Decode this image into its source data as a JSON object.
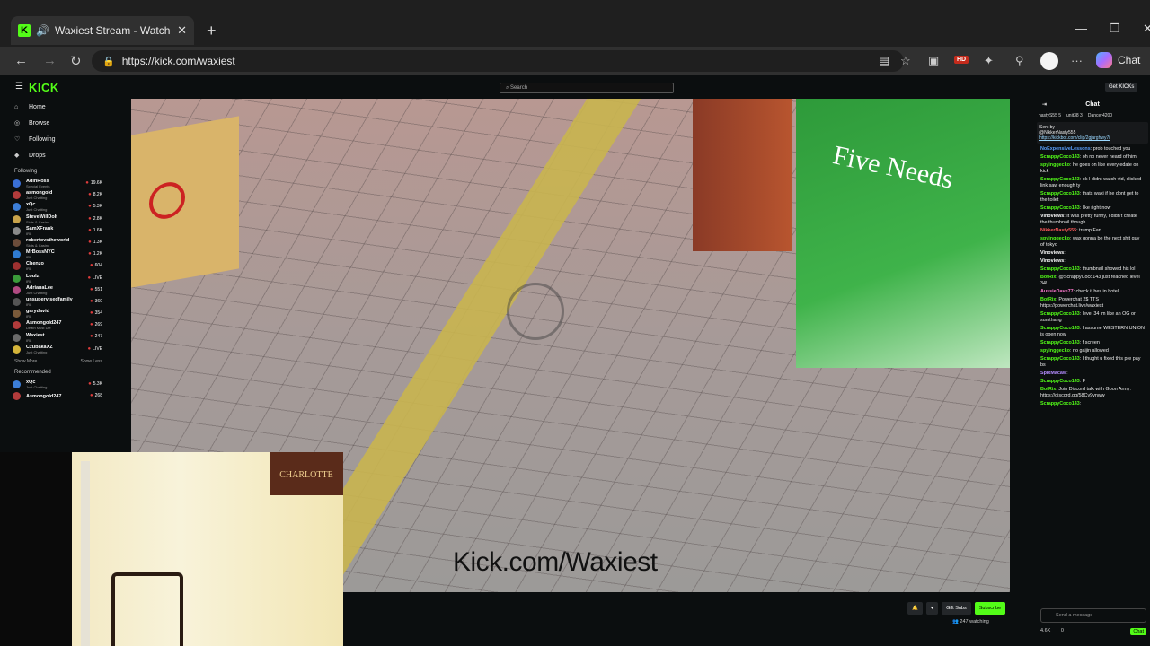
{
  "browser": {
    "tab_title": "Waxiest Stream - Watch Live o",
    "url": "https://kick.com/waxiest",
    "hd_badge": "HD",
    "chat_label": "Chat",
    "new_tab": "+",
    "close": "✕"
  },
  "kick": {
    "logo": "KICK",
    "search_placeholder": "Search",
    "get_kicks": "Get KICKs",
    "nav": [
      {
        "label": "Home",
        "icon": "home-icon"
      },
      {
        "label": "Browse",
        "icon": "browse-icon"
      },
      {
        "label": "Following",
        "icon": "heart-icon"
      },
      {
        "label": "Drops",
        "icon": "drops-icon"
      }
    ],
    "following_heading": "Following",
    "following": [
      {
        "name": "AdinRoss",
        "category": "Special Events",
        "viewers": "19.6K",
        "color": "#3a6fd6"
      },
      {
        "name": "asmongold",
        "category": "Just Chatting",
        "viewers": "8.2K",
        "color": "#b23b3b"
      },
      {
        "name": "xQc",
        "category": "Just Chatting",
        "viewers": "5.3K",
        "color": "#3c7ed8"
      },
      {
        "name": "SteveWillDoIt",
        "category": "Slots & Casino",
        "viewers": "2.8K",
        "color": "#c8a24a"
      },
      {
        "name": "SamXFrank",
        "category": "IRL",
        "viewers": "1.6K",
        "color": "#8a8a8a"
      },
      {
        "name": "robertovstheworld",
        "category": "Slots & Casino",
        "viewers": "1.3K",
        "color": "#6b4c3a"
      },
      {
        "name": "MrBossNYC",
        "category": "IRL",
        "viewers": "1.2K",
        "color": "#2f7bd1"
      },
      {
        "name": "Chenzo",
        "category": "IRL",
        "viewers": "604",
        "color": "#9c3030"
      },
      {
        "name": "Loulz",
        "category": "IRL",
        "viewers": "LIVE",
        "color": "#3a9a3a"
      },
      {
        "name": "AdrianaLee",
        "category": "Just Chatting",
        "viewers": "551",
        "color": "#b04a82"
      },
      {
        "name": "unsupervisedfamily",
        "category": "IRL",
        "viewers": "360",
        "color": "#555"
      },
      {
        "name": "garydavid",
        "category": "IRL",
        "viewers": "354",
        "color": "#7a5a3a"
      },
      {
        "name": "Asmongold247",
        "category": "Death Must Die",
        "viewers": "269",
        "color": "#b23b3b"
      },
      {
        "name": "Waxiest",
        "category": "IRL",
        "viewers": "247",
        "color": "#6a6a6a"
      },
      {
        "name": "CzubakaXZ",
        "category": "Just Chatting",
        "viewers": "LIVE",
        "color": "#d4b43a"
      }
    ],
    "show_more": "Show More",
    "show_less": "Show Less",
    "recommended_heading": "Recommended",
    "recommended": [
      {
        "name": "xQc",
        "category": "Just Chatting",
        "viewers": "5.3K",
        "color": "#3c7ed8"
      },
      {
        "name": "Asmongold247",
        "category": "",
        "viewers": "268",
        "color": "#b23b3b"
      }
    ],
    "watermark": "Kick.com/Waxiest",
    "webcam_poster": "CHARLOTTE",
    "gift_subs": "Gift Subs",
    "subscribe": "Subscribe",
    "watching": "247 watching"
  },
  "chat": {
    "title": "Chat",
    "gifters": [
      "nastyS55 5",
      "unit38 3",
      "Dancer4200"
    ],
    "pinned_by": "Sent by",
    "pinned_user": "@NikkerNasty555",
    "pinned_link": "https://kickbot.com/clip/2gjarghwy7i",
    "messages": [
      {
        "user": "NoExpensiveLessons",
        "color": "#5aa0ff",
        "text": "prob touched you"
      },
      {
        "user": "ScrappyCoco143",
        "color": "#53fc18",
        "text": "oh no never heard of him"
      },
      {
        "user": "spyinggecko",
        "color": "#53fc18",
        "text": "he goes on like every edate on kick"
      },
      {
        "user": "ScrappyCoco143",
        "color": "#53fc18",
        "text": "ok I didnt watch vid, clicked link saw enough ty"
      },
      {
        "user": "ScrappyCoco143",
        "color": "#53fc18",
        "text": "thats waxi if he dont get to the toilet"
      },
      {
        "user": "ScrappyCoco143",
        "color": "#53fc18",
        "text": "like right now"
      },
      {
        "user": "Vinoviews",
        "color": "#ffffff",
        "text": "It was pretty funny, I didn't create the thumbnail though"
      },
      {
        "user": "NikkerNasty555",
        "color": "#ff5a5a",
        "text": "trump Fart"
      },
      {
        "user": "spyinggecko",
        "color": "#53fc18",
        "text": "wax gonna be the next shit guy of tokyo"
      },
      {
        "user": "Vinoviews",
        "color": "#ffffff",
        "text": ""
      },
      {
        "user": "Vinoviews",
        "color": "#ffffff",
        "text": ""
      },
      {
        "user": "ScrappyCoco143",
        "color": "#53fc18",
        "text": "thumbnail showed his lol"
      },
      {
        "user": "BotRix",
        "color": "#53fc18",
        "text": "@ScrappyCoco143 just reached level 34!"
      },
      {
        "user": "AussieDave77",
        "color": "#ff7ad0",
        "text": "check if hes in hotel"
      },
      {
        "user": "BotRix",
        "color": "#53fc18",
        "text": "Powerchat 2$ TTS https://powerchat.live/waxiest"
      },
      {
        "user": "ScrappyCoco143",
        "color": "#53fc18",
        "text": "level 34 im like an OG or sumthang"
      },
      {
        "user": "ScrappyCoco143",
        "color": "#53fc18",
        "text": "I assume WESTERN UNION is open now"
      },
      {
        "user": "ScrappyCoco143",
        "color": "#53fc18",
        "text": "f screen"
      },
      {
        "user": "spyinggecko",
        "color": "#53fc18",
        "text": "no gaijin allowed"
      },
      {
        "user": "ScrappyCoco143",
        "color": "#53fc18",
        "text": "I thught u fixed this pre pay bs"
      },
      {
        "user": "SpixMacaw",
        "color": "#b48cff",
        "text": ""
      },
      {
        "user": "ScrappyCoco143",
        "color": "#53fc18",
        "text": "F"
      },
      {
        "user": "BotRix",
        "color": "#53fc18",
        "text": "Join Discord talk with Goon Army: https://discord.gg/58Cv9vnww"
      },
      {
        "user": "ScrappyCoco143",
        "color": "#53fc18",
        "text": ""
      }
    ],
    "input_placeholder": "Send a message",
    "footer_count": "4.6K",
    "footer_zero": "0",
    "footer_chat": "Chat"
  }
}
